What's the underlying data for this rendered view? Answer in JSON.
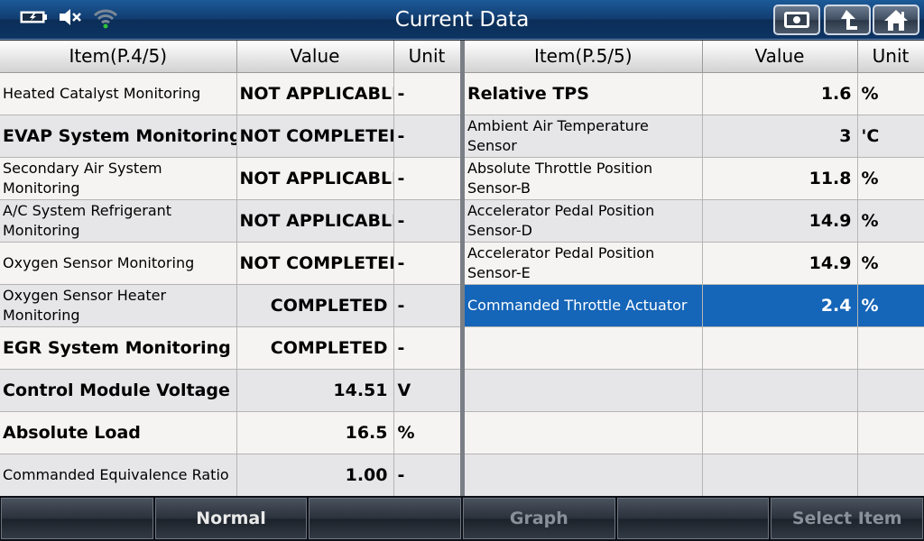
{
  "title": "Current Data",
  "left_table": {
    "headers": [
      "Item(P.4/5)",
      "Value",
      "Unit"
    ],
    "rows": [
      {
        "item": "Heated Catalyst Monitoring",
        "value": "NOT APPLICABLE",
        "unit": "-"
      },
      {
        "item": "EVAP System Monitoring",
        "value": "NOT COMPLETED",
        "unit": "-"
      },
      {
        "item": "Secondary Air System Monitoring",
        "value": "NOT APPLICABLE",
        "unit": "-"
      },
      {
        "item": "A/C System Refrigerant Monitoring",
        "value": "NOT APPLICABLE",
        "unit": "-"
      },
      {
        "item": "Oxygen Sensor Monitoring",
        "value": "NOT COMPLETED",
        "unit": "-"
      },
      {
        "item": "Oxygen Sensor Heater Monitoring",
        "value": "COMPLETED",
        "unit": "-"
      },
      {
        "item": "EGR System Monitoring",
        "value": "COMPLETED",
        "unit": "-"
      },
      {
        "item": "Control Module Voltage",
        "value": "14.51",
        "unit": "V"
      },
      {
        "item": "Absolute Load",
        "value": "16.5",
        "unit": "%"
      },
      {
        "item": "Commanded Equivalence Ratio",
        "value": "1.00",
        "unit": "-"
      }
    ]
  },
  "right_table": {
    "headers": [
      "Item(P.5/5)",
      "Value",
      "Unit"
    ],
    "rows": [
      {
        "item": "Relative TPS",
        "value": "1.6",
        "unit": "%"
      },
      {
        "item": "Ambient Air Temperature Sensor",
        "value": "3",
        "unit": "'C"
      },
      {
        "item": "Absolute Throttle Position Sensor-B",
        "value": "11.8",
        "unit": "%"
      },
      {
        "item": "Accelerator Pedal Position Sensor-D",
        "value": "14.9",
        "unit": "%"
      },
      {
        "item": "Accelerator Pedal Position Sensor-E",
        "value": "14.9",
        "unit": "%"
      },
      {
        "item": "Commanded Throttle Actuator",
        "value": "2.4",
        "unit": "%"
      },
      {
        "item": "",
        "value": "",
        "unit": ""
      },
      {
        "item": "",
        "value": "",
        "unit": ""
      },
      {
        "item": "",
        "value": "",
        "unit": ""
      },
      {
        "item": "",
        "value": "",
        "unit": ""
      }
    ]
  },
  "bottom_buttons": [
    "",
    "Normal",
    "",
    "Graph",
    "",
    "Select Item"
  ],
  "icons": {
    "battery": "battery-icon",
    "mute": "speaker-muted-icon",
    "wifi": "wifi-icon",
    "record": "record-icon",
    "back": "back-arrow-icon",
    "home": "home-icon"
  },
  "colors": {
    "title_bar": "#113d70",
    "selected_row": "#1565b8",
    "wifi_dot": "#2ec23a"
  }
}
